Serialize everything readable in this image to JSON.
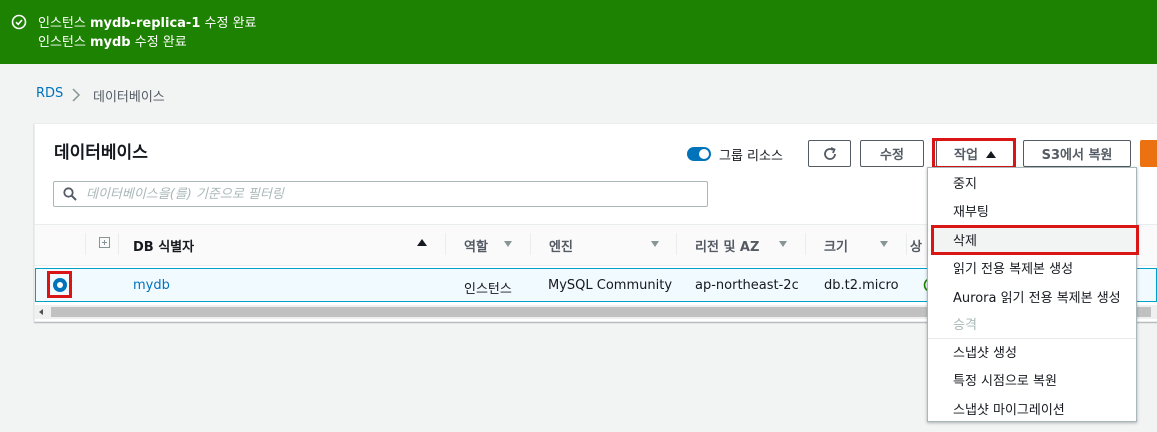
{
  "banner": {
    "line1_prefix": "인스턴스 ",
    "line1_name": "mydb-replica-1",
    "line1_suffix": " 수정 완료",
    "line2_prefix": "인스턴스 ",
    "line2_name": "mydb",
    "line2_suffix": " 수정 완료",
    "color": "#1d8102"
  },
  "breadcrumb": {
    "root": "RDS",
    "current": "데이터베이스"
  },
  "panel": {
    "title": "데이터베이스"
  },
  "toolbar": {
    "group_toggle_label": "그룹 리소스",
    "group_toggle_on": true,
    "edit_label": "수정",
    "actions_label": "작업",
    "restore_label": "S3에서 복원"
  },
  "search": {
    "placeholder": "데이터베이스을(를) 기준으로 필터링",
    "value": ""
  },
  "table": {
    "headers": [
      "DB 식별자",
      "역할",
      "엔진",
      "리전 및 AZ",
      "크기",
      "상"
    ],
    "rows": [
      {
        "identifier": "mydb",
        "role": "인스턴스",
        "engine": "MySQL Community",
        "region_az": "ap-northeast-2c",
        "size": "db.t2.micro",
        "selected": true
      }
    ]
  },
  "actions_menu": {
    "items": [
      {
        "label": "중지",
        "enabled": true
      },
      {
        "label": "재부팅",
        "enabled": true
      },
      {
        "label": "삭제",
        "enabled": true,
        "highlighted": true
      },
      {
        "label": "읽기 전용 복제본 생성",
        "enabled": true
      },
      {
        "label": "Aurora 읽기 전용 복제본 생성",
        "enabled": true
      },
      {
        "label": "승격",
        "enabled": false
      },
      {
        "label": "스냅샷 생성",
        "enabled": true
      },
      {
        "label": "특정 시점으로 복원",
        "enabled": true
      },
      {
        "label": "스냅샷 마이그레이션",
        "enabled": true
      }
    ]
  },
  "colors": {
    "link": "#0073bb",
    "highlight_border": "#d91515",
    "primary_button": "#ec7211",
    "success": "#1d8102"
  },
  "icons": {
    "banner": "check-circle-icon",
    "breadcrumb_separator": "chevron-right-icon",
    "refresh": "refresh-icon",
    "search": "search-icon",
    "actions_caret": "caret-up-icon",
    "status": "check-circle-icon"
  }
}
